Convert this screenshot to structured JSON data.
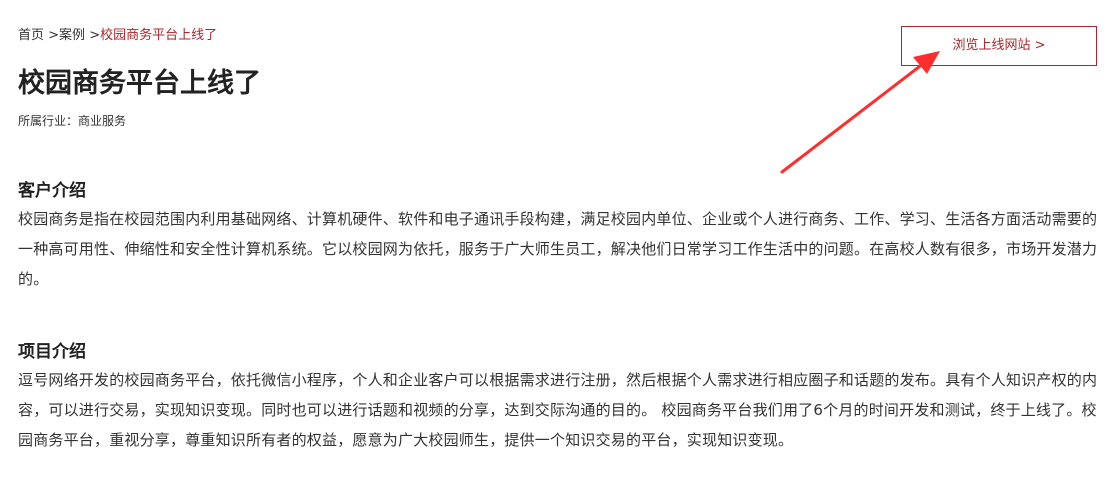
{
  "breadcrumb": {
    "home": "首页",
    "separator1": " >",
    "cases": "案例",
    "separator2": " >",
    "current": "校园商务平台上线了"
  },
  "visit_button": {
    "label": "浏览上线网站 >"
  },
  "page": {
    "title": "校园商务平台上线了",
    "industry": "所属行业：商业服务"
  },
  "sections": {
    "client": {
      "heading": "客户介绍",
      "body": "校园商务是指在校园范围内利用基础网络、计算机硬件、软件和电子通讯手段构建，满足校园内单位、企业或个人进行商务、工作、学习、生活各方面活动需要的一种高可用性、伸缩性和安全性计算机系统。它以校园网为依托，服务于广大师生员工，解决他们日常学习工作生活中的问题。在高校人数有很多，市场开发潜力的。"
    },
    "project": {
      "heading": "项目介绍",
      "body": "逗号网络开发的校园商务平台，依托微信小程序，个人和企业客户可以根据需求进行注册，然后根据个人需求进行相应圈子和话题的发布。具有个人知识产权的内容，可以进行交易，实现知识变现。同时也可以进行话题和视频的分享，达到交际沟通的目的。 校园商务平台我们用了6个月的时间开发和测试，终于上线了。校园商务平台，重视分享，尊重知识所有者的权益，愿意为广大校园师生，提供一个知识交易的平台，实现知识变现。"
    }
  },
  "colors": {
    "accent": "#a8262c",
    "annotation_arrow": "#ff2d2d",
    "text": "#333333"
  }
}
